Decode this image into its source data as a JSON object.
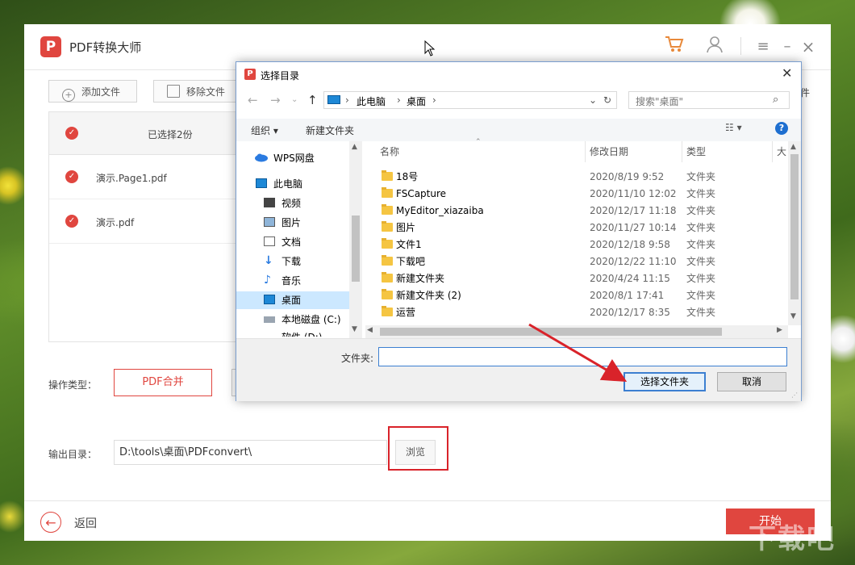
{
  "app": {
    "logo_letter": "P",
    "title": "PDF转换大师",
    "toolbar": {
      "add_file": "添加文件",
      "remove_file": "移除文件",
      "right_cut": "件"
    },
    "file_list": {
      "header": "已选择2份",
      "files": [
        "演示.Page1.pdf",
        "演示.pdf"
      ]
    },
    "operation": {
      "label": "操作类型：",
      "selected": "PDF合并"
    },
    "output": {
      "label": "输出目录：",
      "path": "D:\\tools\\桌面\\PDFconvert\\",
      "browse": "浏览"
    },
    "footer": {
      "back": "返回",
      "start": "开始"
    },
    "colors": {
      "accent": "#e0463f",
      "highlight_box": "#d9232a"
    }
  },
  "dialog": {
    "title": "选择目录",
    "breadcrumb": [
      "此电脑",
      "桌面"
    ],
    "search_placeholder": "搜索\"桌面\"",
    "commands": {
      "organize": "组织",
      "new_folder": "新建文件夹"
    },
    "sidebar": [
      {
        "label": "WPS网盘",
        "icon": "cloud-icon"
      },
      {
        "label": "此电脑",
        "icon": "computer-icon"
      },
      {
        "label": "视频",
        "icon": "video-icon"
      },
      {
        "label": "图片",
        "icon": "picture-icon"
      },
      {
        "label": "文档",
        "icon": "document-icon"
      },
      {
        "label": "下载",
        "icon": "download-icon"
      },
      {
        "label": "音乐",
        "icon": "music-icon"
      },
      {
        "label": "桌面",
        "icon": "desktop-icon"
      },
      {
        "label": "本地磁盘 (C:)",
        "icon": "drive-icon"
      },
      {
        "label": "软件 (D:)",
        "icon": "drive-icon"
      }
    ],
    "columns": {
      "name": "名称",
      "date": "修改日期",
      "type": "类型",
      "size": "大"
    },
    "rows": [
      {
        "name": "18号",
        "date": "2020/8/19 9:52",
        "type": "文件夹"
      },
      {
        "name": "FSCapture",
        "date": "2020/11/10 12:02",
        "type": "文件夹"
      },
      {
        "name": "MyEditor_xiazaiba",
        "date": "2020/12/17 11:18",
        "type": "文件夹"
      },
      {
        "name": "图片",
        "date": "2020/11/27 10:14",
        "type": "文件夹"
      },
      {
        "name": "文件1",
        "date": "2020/12/18 9:58",
        "type": "文件夹"
      },
      {
        "name": "下载吧",
        "date": "2020/12/22 11:10",
        "type": "文件夹"
      },
      {
        "name": "新建文件夹",
        "date": "2020/4/24 11:15",
        "type": "文件夹"
      },
      {
        "name": "新建文件夹 (2)",
        "date": "2020/8/1 17:41",
        "type": "文件夹"
      },
      {
        "name": "运营",
        "date": "2020/12/17 8:35",
        "type": "文件夹"
      }
    ],
    "folder_label": "文件夹:",
    "folder_value": "",
    "ok": "选择文件夹",
    "cancel": "取消"
  },
  "watermark": "下载吧"
}
